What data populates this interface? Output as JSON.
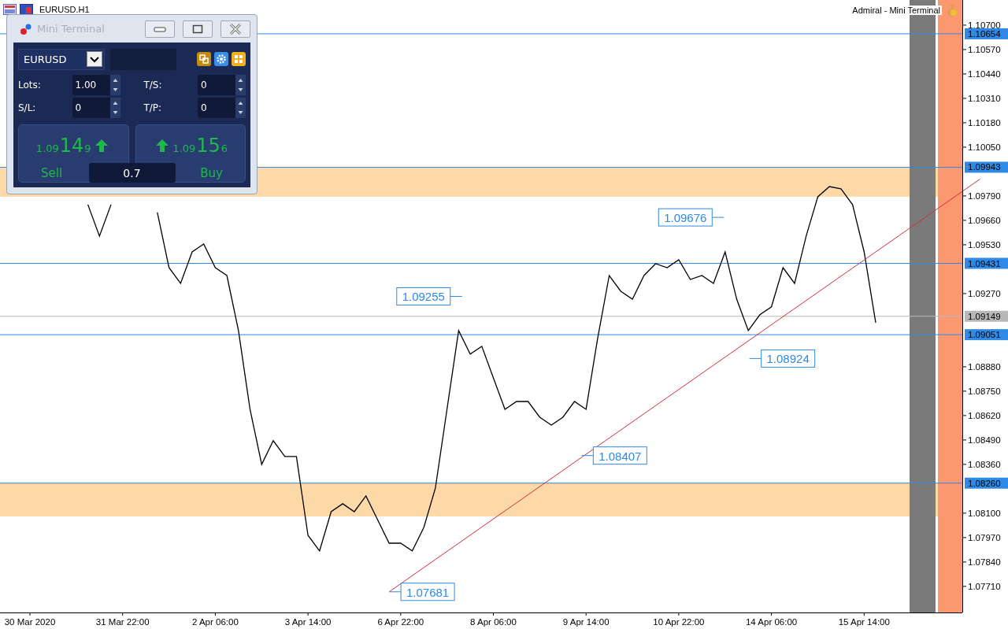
{
  "chart_header": {
    "indicator": "Admiral - Mini Terminal"
  },
  "mini_terminal": {
    "title": "Mini Terminal",
    "symbol": "EURUSD",
    "fields": [
      {
        "label": "Lots:",
        "value": "1.00"
      },
      {
        "label": "T/S:",
        "value": "0"
      },
      {
        "label": "S/L:",
        "value": "0"
      },
      {
        "label": "T/P:",
        "value": "0"
      }
    ],
    "sell": {
      "label": "Sell",
      "price_prefix": "1.09",
      "price_big": "14",
      "price_small": "9"
    },
    "buy": {
      "label": "Buy",
      "price_prefix": "1.09",
      "price_big": "15",
      "price_small": "6"
    },
    "volume": "0.7"
  },
  "chart": {
    "chart_data": {
      "type": "line",
      "title": "EURUSD.H1",
      "ylim": [
        1.07571,
        1.10834
      ],
      "categories": [
        "30 Mar 2020",
        null,
        null,
        null,
        null,
        null,
        null,
        null,
        "31 Mar 22:00",
        null,
        null,
        null,
        null,
        null,
        null,
        null,
        "2 Apr 06:00",
        null,
        null,
        null,
        null,
        null,
        null,
        null,
        "3 Apr 14:00",
        null,
        null,
        null,
        null,
        null,
        null,
        null,
        "6 Apr 22:00",
        null,
        null,
        null,
        null,
        null,
        null,
        null,
        "8 Apr 06:00",
        null,
        null,
        null,
        null,
        null,
        null,
        null,
        "9 Apr 14:00",
        null,
        null,
        null,
        null,
        null,
        null,
        null,
        "10 Apr 22:00",
        null,
        null,
        null,
        null,
        null,
        null,
        null,
        "14 Apr 06:00",
        null,
        null,
        null,
        null,
        null,
        null,
        null,
        "15 Apr 14:00",
        null,
        null,
        null,
        null,
        null,
        null,
        null,
        null
      ],
      "series": [
        {
          "color": "#000000",
          "values": [
            null,
            null,
            null,
            null,
            null,
            1.09744,
            1.09576,
            1.09744,
            null,
            null,
            null,
            1.09702,
            1.09408,
            1.09324,
            1.09492,
            1.09534,
            1.09408,
            1.09366,
            1.09073,
            1.08653,
            1.0836,
            1.08486,
            1.08402,
            1.08402,
            1.07982,
            1.07899,
            1.08108,
            1.0815,
            1.08108,
            1.08192,
            1.08066,
            1.0794,
            1.0794,
            1.07899,
            1.08024,
            1.08234,
            1.08653,
            1.09073,
            1.08947,
            1.08989,
            1.08821,
            1.08653,
            1.08695,
            1.08695,
            1.08611,
            1.08569,
            1.08611,
            1.08695,
            1.08653,
            1.09031,
            1.09366,
            1.09282,
            1.0924,
            1.09366,
            1.09429,
            1.09408,
            1.0945,
            1.09345,
            1.09366,
            1.09324,
            1.09492,
            1.0924,
            1.09073,
            1.09157,
            1.09199,
            1.09408,
            1.09324,
            1.09576,
            1.09786,
            1.0984,
            1.09828,
            1.09744,
            1.09492,
            1.09115,
            null,
            null,
            null,
            null,
            null,
            null,
            null
          ]
        }
      ],
      "yticks": [
        {
          "value": 1.107,
          "label": "1.10700"
        },
        {
          "value": 1.1057,
          "label": "1.10570"
        },
        {
          "value": 1.1044,
          "label": "1.10440"
        },
        {
          "value": 1.1031,
          "label": "1.10310"
        },
        {
          "value": 1.1018,
          "label": "1.10180"
        },
        {
          "value": 1.1005,
          "label": "1.10050"
        },
        {
          "value": 1.0979,
          "label": "1.09790"
        },
        {
          "value": 1.0966,
          "label": "1.09660"
        },
        {
          "value": 1.0953,
          "label": "1.09530"
        },
        {
          "value": 1.0927,
          "label": "1.09270"
        },
        {
          "value": 1.0888,
          "label": "1.08880"
        },
        {
          "value": 1.0875,
          "label": "1.08750"
        },
        {
          "value": 1.0862,
          "label": "1.08620"
        },
        {
          "value": 1.0849,
          "label": "1.08490"
        },
        {
          "value": 1.0836,
          "label": "1.08360"
        },
        {
          "value": 1.081,
          "label": "1.08100"
        },
        {
          "value": 1.0797,
          "label": "1.07970"
        },
        {
          "value": 1.0784,
          "label": "1.07840"
        },
        {
          "value": 1.0771,
          "label": "1.07710"
        }
      ],
      "bands": [
        {
          "axis": "y",
          "from": 1.09786,
          "to": 1.09943,
          "color": "#fdd9a8"
        },
        {
          "axis": "y",
          "from": 1.08083,
          "to": 1.0826,
          "color": "#fdd9a8"
        }
      ],
      "ref_lines": [
        {
          "axis": "y",
          "value": 1.10654,
          "label": "1.10654",
          "color": "#2e8ae6"
        },
        {
          "axis": "y",
          "value": 1.09943,
          "label": "1.09943",
          "color": "#2e8ae6"
        },
        {
          "axis": "y",
          "value": 1.09431,
          "label": "1.09431",
          "color": "#2e8ae6"
        },
        {
          "axis": "y",
          "value": 1.09149,
          "label": "1.09149",
          "color": "#b8b8b8"
        },
        {
          "axis": "y",
          "value": 1.09051,
          "label": "1.09051",
          "color": "#2e8ae6"
        },
        {
          "axis": "y",
          "value": 1.0826,
          "label": "1.08260",
          "color": "#2e8ae6"
        }
      ]
    },
    "callouts": [
      {
        "label": "1.09255"
      },
      {
        "label": "1.09676"
      },
      {
        "label": "1.08924"
      },
      {
        "label": "1.08407"
      },
      {
        "label": "1.07681"
      }
    ]
  }
}
